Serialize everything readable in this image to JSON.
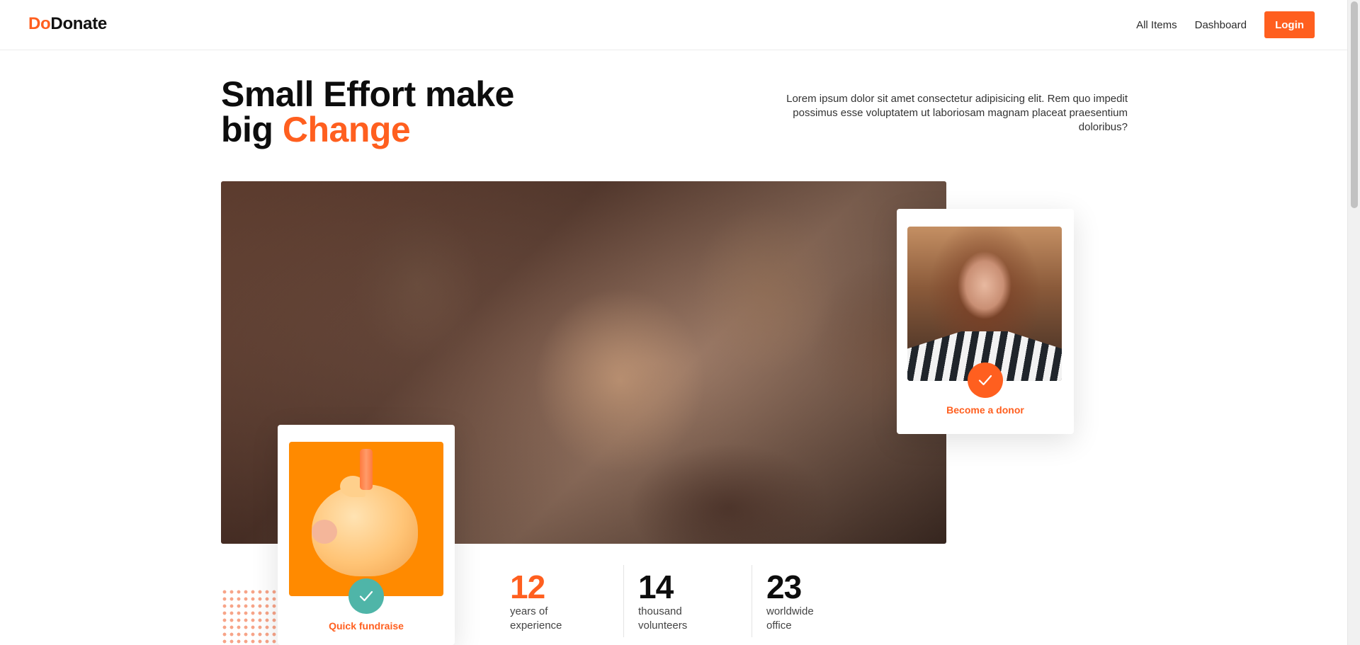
{
  "brand": {
    "prefix": "Do",
    "suffix": "Donate"
  },
  "nav": {
    "items": [
      {
        "label": "All Items"
      },
      {
        "label": "Dashboard"
      }
    ],
    "login_label": "Login"
  },
  "hero": {
    "title_line1": "Small Effort make",
    "title_line2_prefix": "big ",
    "title_line2_accent": "Change",
    "description": "Lorem ipsum dolor sit amet consectetur adipisicing elit. Rem quo impedit possimus esse voluptatem ut laboriosam magnam placeat praesentium doloribus?"
  },
  "cards": {
    "donor_label": "Become a donor",
    "fundraise_label": "Quick fundraise"
  },
  "stats": [
    {
      "number": "12",
      "caption_line1": "years of",
      "caption_line2": "experience",
      "color": "#ff5f1f"
    },
    {
      "number": "14",
      "caption_line1": "thousand",
      "caption_line2": "volunteers",
      "color": "#0d0d0d"
    },
    {
      "number": "23",
      "caption_line1": "worldwide",
      "caption_line2": "office",
      "color": "#0d0d0d"
    }
  ],
  "colors": {
    "accent": "#ff5f1f",
    "teal": "#4fb5a8",
    "fund_bg": "#ff8a00"
  },
  "icons": {
    "donor_check": "check-icon",
    "fund_check": "check-icon"
  }
}
